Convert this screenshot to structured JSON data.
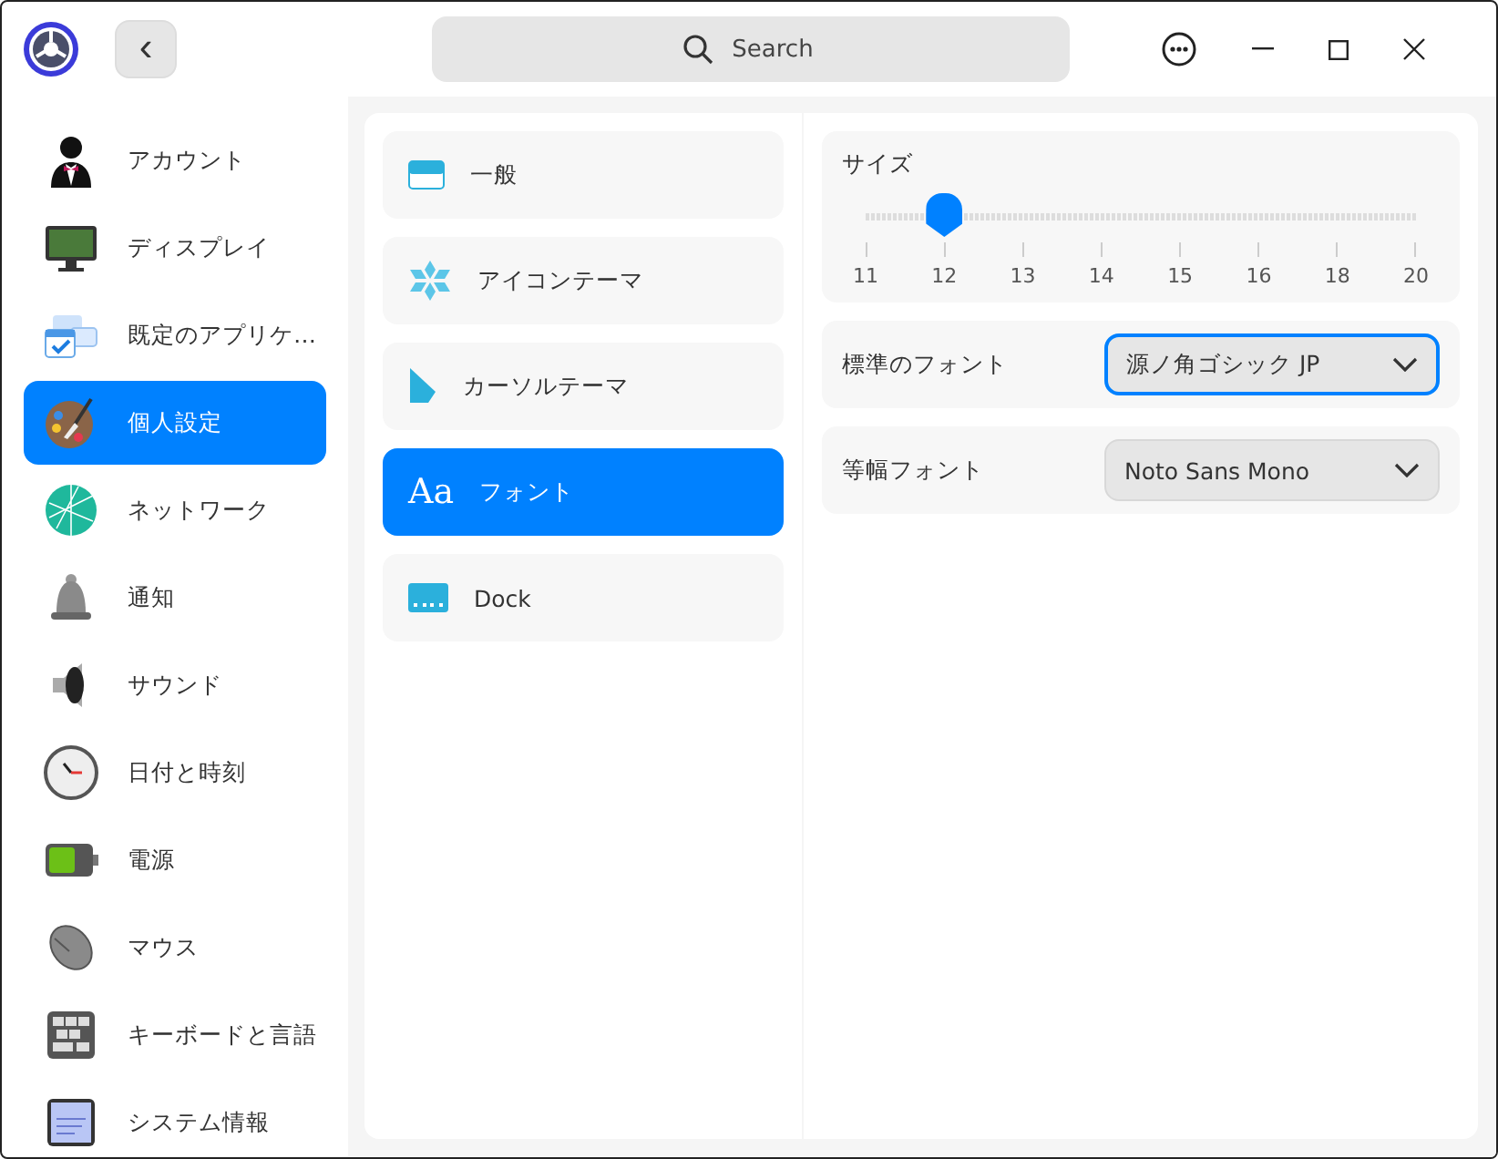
{
  "titlebar": {
    "back_button": "‹",
    "search": {
      "placeholder": "Search"
    }
  },
  "sidebar": {
    "items": [
      {
        "label": "アカウント",
        "selected": false
      },
      {
        "label": "ディスプレイ",
        "selected": false
      },
      {
        "label": "既定のアプリケ…",
        "selected": false
      },
      {
        "label": "個人設定",
        "selected": true
      },
      {
        "label": "ネットワーク",
        "selected": false
      },
      {
        "label": "通知",
        "selected": false
      },
      {
        "label": "サウンド",
        "selected": false
      },
      {
        "label": "日付と時刻",
        "selected": false
      },
      {
        "label": "電源",
        "selected": false
      },
      {
        "label": "マウス",
        "selected": false
      },
      {
        "label": "キーボードと言語",
        "selected": false
      },
      {
        "label": "システム情報",
        "selected": false
      }
    ]
  },
  "subsections": [
    {
      "label": "一般",
      "selected": false
    },
    {
      "label": "アイコンテーマ",
      "selected": false
    },
    {
      "label": "カーソルテーマ",
      "selected": false
    },
    {
      "label": "フォント",
      "selected": true,
      "icon_text": "Aa"
    },
    {
      "label": "Dock",
      "selected": false
    }
  ],
  "font_settings": {
    "size": {
      "label": "サイズ",
      "level": 0.143,
      "ticks": [
        "11",
        "12",
        "13",
        "14",
        "15",
        "16",
        "18",
        "20"
      ]
    },
    "fields": [
      {
        "label": "標準のフォント",
        "value": "源ノ角ゴシック JP",
        "focused": true
      },
      {
        "label": "等幅フォント",
        "value": "Noto Sans Mono",
        "focused": false
      }
    ]
  }
}
